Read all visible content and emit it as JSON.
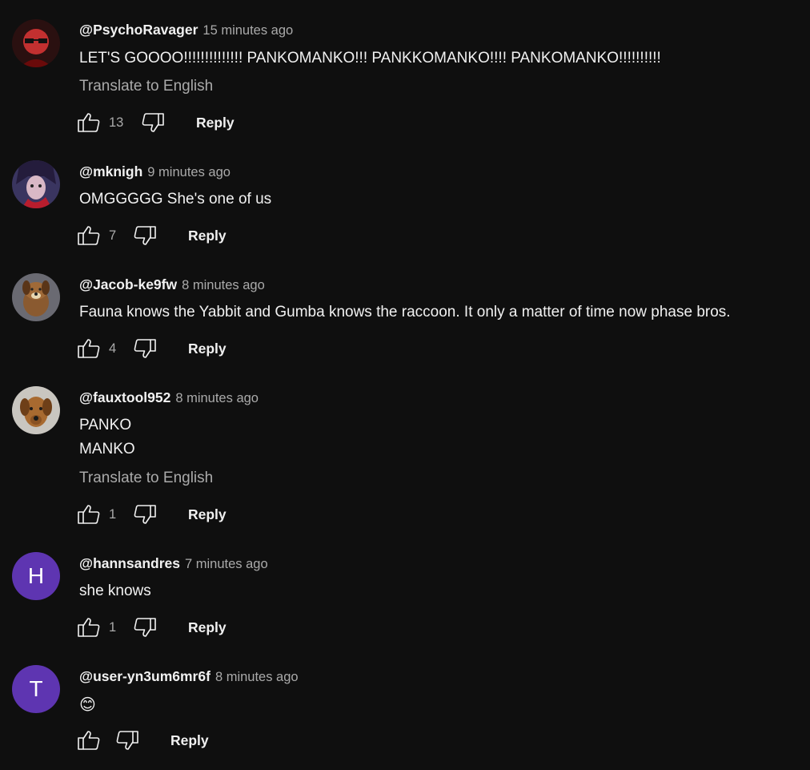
{
  "comments": [
    {
      "author": "@PsychoRavager",
      "time": "15 minutes ago",
      "lines": [
        "LET'S GOOOO!!!!!!!!!!!!!! PANKOMANKO!!! PANKKOMANKO!!!! PANKOMANKO!!!!!!!!!!"
      ],
      "translate": "Translate to English",
      "likes": "13",
      "reply": "Reply"
    },
    {
      "author": "@mknigh",
      "time": "9 minutes ago",
      "lines": [
        "OMGGGGG She's one of us"
      ],
      "likes": "7",
      "reply": "Reply"
    },
    {
      "author": "@Jacob-ke9fw",
      "time": "8 minutes ago",
      "lines": [
        "Fauna knows the Yabbit and Gumba knows the raccoon. It only a matter of time now phase bros."
      ],
      "likes": "4",
      "reply": "Reply"
    },
    {
      "author": "@fauxtool952",
      "time": "8 minutes ago",
      "lines": [
        "PANKO",
        "MANKO"
      ],
      "translate": "Translate to English",
      "likes": "1",
      "reply": "Reply"
    },
    {
      "author": "@hannsandres",
      "avatar_letter": "H",
      "time": "7 minutes ago",
      "lines": [
        "she knows"
      ],
      "likes": "1",
      "reply": "Reply"
    },
    {
      "author": "@user-yn3um6mr6f",
      "avatar_letter": "T",
      "time": "8 minutes ago",
      "lines": [
        "😊"
      ],
      "reply": "Reply"
    }
  ],
  "colors": {
    "background": "#0f0f0f",
    "avatar_letter_bg": "#5e35b1",
    "secondary_text": "#aaaaaa"
  }
}
